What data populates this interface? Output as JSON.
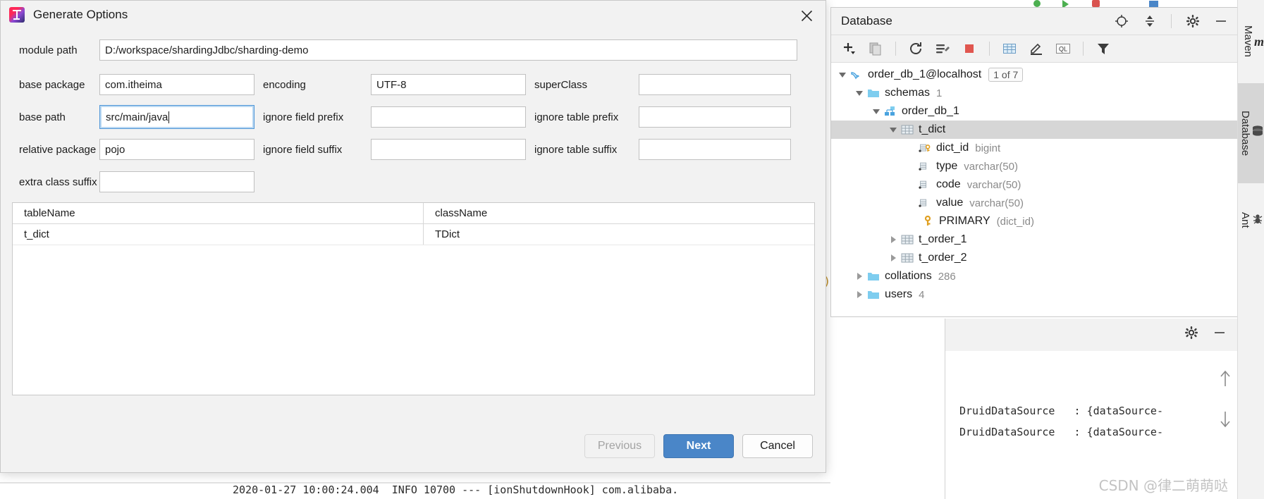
{
  "dialog": {
    "title": "Generate Options",
    "icon": "intellij-idea-logo",
    "close_icon": "close-icon",
    "fields": [
      {
        "name": "module-path",
        "label": "module path",
        "value": "D:/workspace/shardingJdbc/sharding-demo",
        "placeholder": "",
        "focused": false
      },
      {
        "name": "base-package",
        "label": "base package",
        "value": "com.itheima",
        "placeholder": "",
        "focused": false
      },
      {
        "name": "encoding",
        "label": "encoding",
        "value": "UTF-8",
        "placeholder": "",
        "focused": false
      },
      {
        "name": "super-class",
        "label": "superClass",
        "value": "",
        "placeholder": "",
        "focused": false
      },
      {
        "name": "base-path",
        "label": "base path",
        "value": "src/main/java",
        "placeholder": "",
        "focused": true
      },
      {
        "name": "ignore-field-prefix",
        "label": "ignore field prefix",
        "value": "",
        "placeholder": "",
        "focused": false
      },
      {
        "name": "ignore-table-prefix",
        "label": "ignore table prefix",
        "value": "",
        "placeholder": "",
        "focused": false
      },
      {
        "name": "relative-package",
        "label": "relative package",
        "value": "pojo",
        "placeholder": "",
        "focused": false
      },
      {
        "name": "ignore-field-suffix",
        "label": "ignore field suffix",
        "value": "",
        "placeholder": "",
        "focused": false
      },
      {
        "name": "ignore-table-suffix",
        "label": "ignore table suffix",
        "value": "",
        "placeholder": "",
        "focused": false
      },
      {
        "name": "extra-class-suffix",
        "label": "extra class suffix",
        "value": "",
        "placeholder": "",
        "focused": false
      }
    ],
    "table": {
      "columns": [
        "tableName",
        "className"
      ],
      "rows": [
        {
          "tableName": "t_dict",
          "className": "TDict"
        }
      ]
    },
    "buttons": {
      "previous": "Previous",
      "previous_enabled": false,
      "next": "Next",
      "next_primary": true,
      "cancel": "Cancel"
    }
  },
  "database_panel": {
    "title": "Database",
    "header_actions": [
      {
        "name": "locate-in-tree-icon",
        "label": ""
      },
      {
        "name": "collapse-all-icon",
        "label": ""
      },
      {
        "name": "settings-gear-icon",
        "label": ""
      },
      {
        "name": "hide-panel-icon",
        "label": ""
      }
    ],
    "toolbar": [
      {
        "name": "add-data-source-icon",
        "label": ""
      },
      {
        "name": "duplicate-icon",
        "label": ""
      },
      {
        "name": "refresh-icon",
        "label": ""
      },
      {
        "name": "run-sql-script-icon",
        "label": ""
      },
      {
        "name": "stop-icon",
        "label": ""
      },
      {
        "name": "open-table-editor-icon",
        "label": ""
      },
      {
        "name": "modify-object-icon",
        "label": ""
      },
      {
        "name": "open-query-console-icon",
        "label": "QL"
      },
      {
        "name": "filter-icon",
        "label": ""
      }
    ],
    "tree": [
      {
        "name": "data-source-order-db-1",
        "label": "order_db_1@localhost",
        "badge": "1 of 7",
        "sub": "",
        "icon": "mysql-dolphin-icon",
        "indent": 0,
        "expanded": true,
        "selected": false
      },
      {
        "name": "folder-schemas",
        "label": "schemas",
        "badge": "",
        "sub": "1",
        "icon": "folder-icon",
        "indent": 1,
        "expanded": true,
        "selected": false
      },
      {
        "name": "schema-order-db-1",
        "label": "order_db_1",
        "badge": "",
        "sub": "",
        "icon": "schema-icon",
        "indent": 2,
        "expanded": true,
        "selected": false
      },
      {
        "name": "table-t-dict",
        "label": "t_dict",
        "badge": "",
        "sub": "",
        "icon": "table-icon",
        "indent": 3,
        "expanded": true,
        "selected": true
      },
      {
        "name": "column-dict-id",
        "label": "dict_id",
        "badge": "",
        "sub": "bigint",
        "icon": "primary-key-column-icon",
        "indent": 4,
        "expanded": null,
        "selected": false
      },
      {
        "name": "column-type",
        "label": "type",
        "badge": "",
        "sub": "varchar(50)",
        "icon": "column-icon",
        "indent": 4,
        "expanded": null,
        "selected": false
      },
      {
        "name": "column-code",
        "label": "code",
        "badge": "",
        "sub": "varchar(50)",
        "icon": "column-icon",
        "indent": 4,
        "expanded": null,
        "selected": false
      },
      {
        "name": "column-value",
        "label": "value",
        "badge": "",
        "sub": "varchar(50)",
        "icon": "column-icon",
        "indent": 4,
        "expanded": null,
        "selected": false
      },
      {
        "name": "index-primary",
        "label": "PRIMARY",
        "badge": "",
        "sub": "(dict_id)",
        "icon": "key-icon",
        "indent": 4,
        "expanded": null,
        "selected": false
      },
      {
        "name": "table-t-order-1",
        "label": "t_order_1",
        "badge": "",
        "sub": "",
        "icon": "table-icon",
        "indent": 3,
        "expanded": false,
        "selected": false
      },
      {
        "name": "table-t-order-2",
        "label": "t_order_2",
        "badge": "",
        "sub": "",
        "icon": "table-icon",
        "indent": 3,
        "expanded": false,
        "selected": false
      },
      {
        "name": "folder-collations",
        "label": "collations",
        "badge": "",
        "sub": "286",
        "icon": "folder-icon",
        "indent": 1,
        "expanded": false,
        "selected": false
      },
      {
        "name": "folder-users",
        "label": "users",
        "badge": "",
        "sub": "4",
        "icon": "folder-icon",
        "indent": 1,
        "expanded": false,
        "selected": false
      }
    ]
  },
  "right_rail": {
    "items": [
      {
        "name": "rail-maven",
        "label": "Maven",
        "icon": "maven-m-icon",
        "active": false
      },
      {
        "name": "rail-database",
        "label": "Database",
        "icon": "database-cylinder-icon",
        "active": true
      },
      {
        "name": "rail-ant",
        "label": "Ant",
        "icon": "ant-bug-icon",
        "active": false
      }
    ]
  },
  "console": {
    "header_actions": [
      {
        "name": "console-settings-gear-icon",
        "label": ""
      },
      {
        "name": "console-hide-icon",
        "label": ""
      }
    ],
    "scroll_buttons": [
      {
        "name": "scroll-up-icon",
        "label": ""
      },
      {
        "name": "scroll-down-icon",
        "label": ""
      }
    ],
    "lines": [
      "DruidDataSource   : {dataSource-",
      "DruidDataSource   : {dataSource-"
    ],
    "background_log_line": "2020-01-27 10:00:24.004  INFO 10700 --- [ionShutdownHook] com.alibaba.",
    "watermark": "CSDN @律二萌萌哒"
  }
}
